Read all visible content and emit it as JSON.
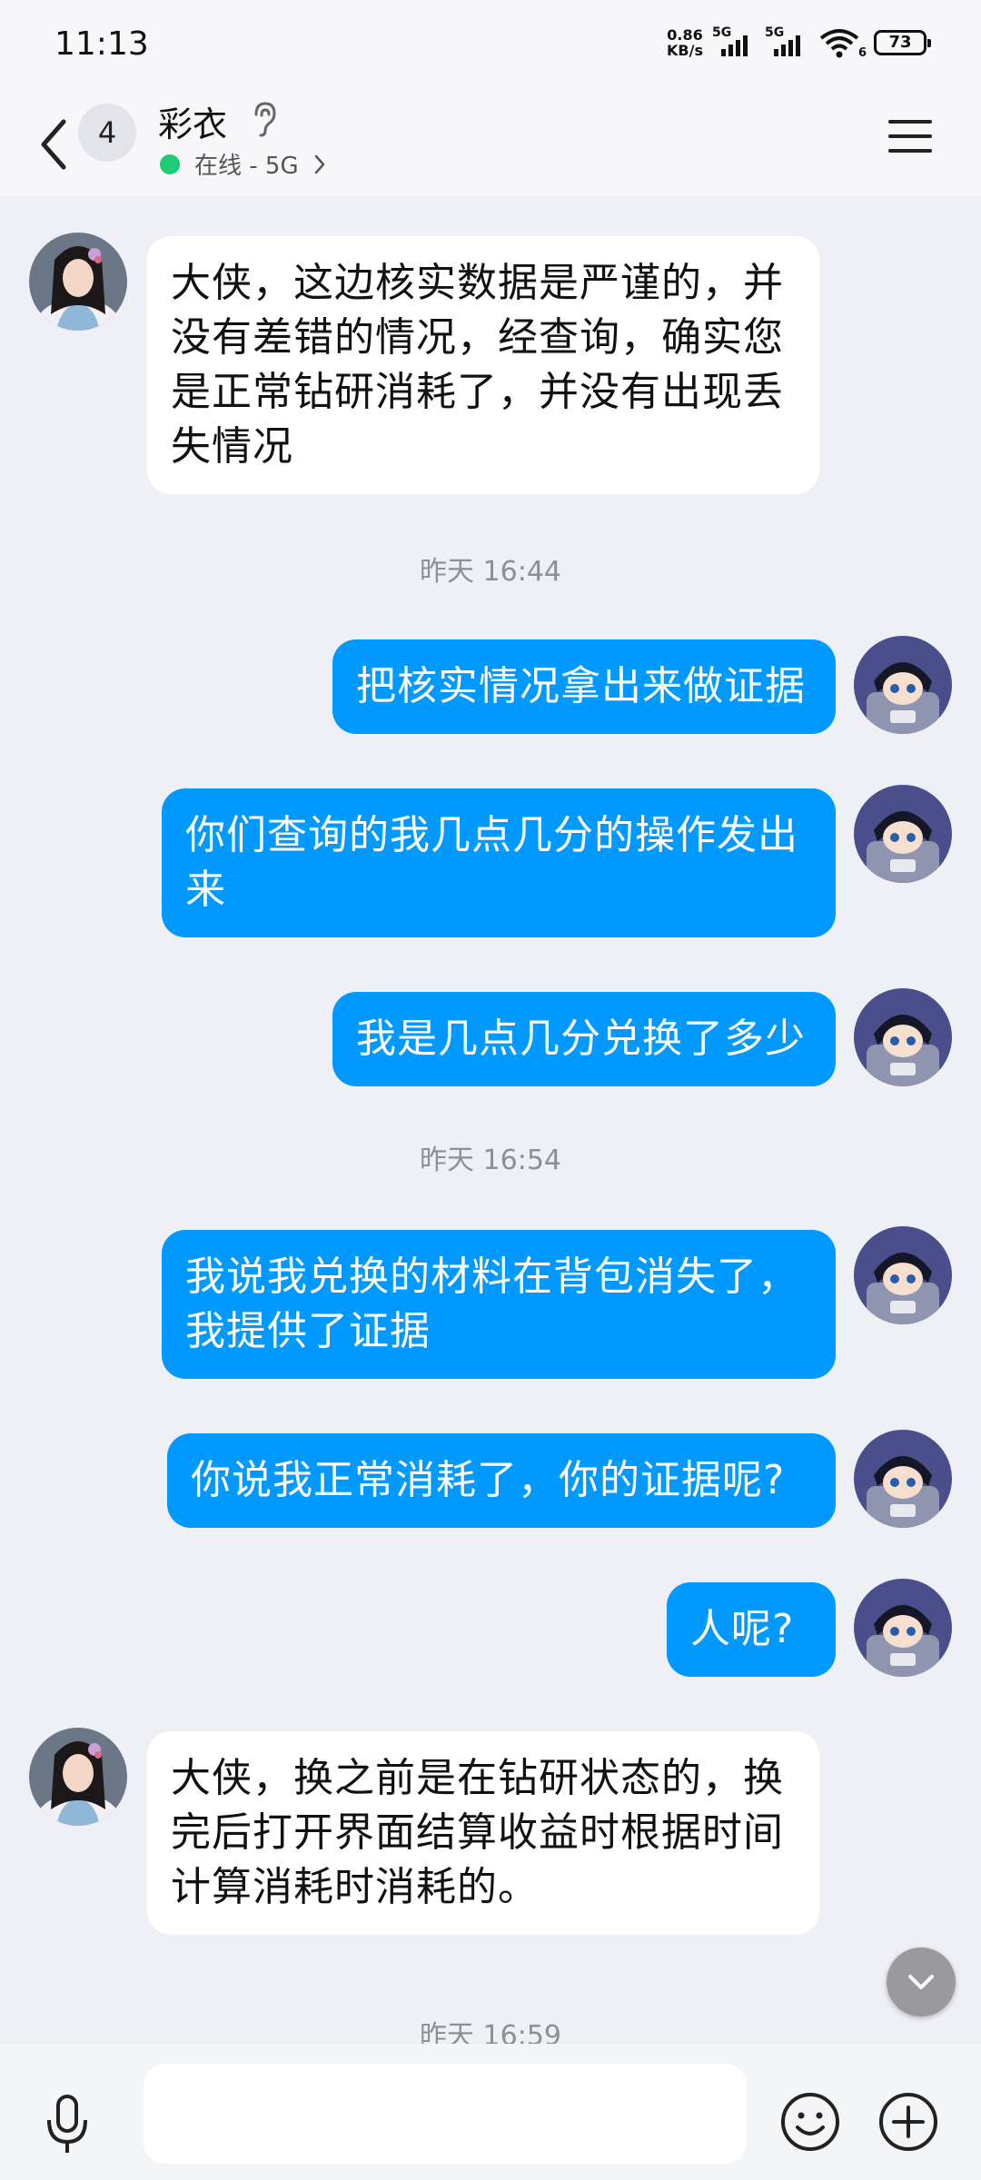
{
  "status_bar": {
    "time": "11:13",
    "net_speed_value": "0.86",
    "net_speed_unit": "KB/s",
    "sim1_label": "5G",
    "sim2_label": "5G",
    "wifi_label": "6",
    "battery": "73"
  },
  "header": {
    "unread_count": "4",
    "contact_name": "彩衣",
    "status_text": "在线 - 5G"
  },
  "messages": [
    {
      "side": "in",
      "text": "大侠，这边核实数据是严谨的，并没有差错的情况，经查询，确实您是正常钻研消耗了，并没有出现丢失情况"
    },
    {
      "type": "time",
      "text": "昨天 16:44"
    },
    {
      "side": "out",
      "text": "把核实情况拿出来做证据"
    },
    {
      "side": "out",
      "text": "你们查询的我几点几分的操作发出来"
    },
    {
      "side": "out",
      "text": "我是几点几分兑换了多少"
    },
    {
      "type": "time",
      "text": "昨天 16:54"
    },
    {
      "side": "out",
      "text": "我说我兑换的材料在背包消失了，我提供了证据"
    },
    {
      "side": "out",
      "text": "你说我正常消耗了，你的证据呢?"
    },
    {
      "side": "out",
      "text": "人呢?"
    },
    {
      "side": "in",
      "text": "大侠，换之前是在钻研状态的，换完后打开界面结算收益时根据时间计算消耗时消耗的。"
    },
    {
      "type": "time",
      "text": "昨天 16:59"
    }
  ],
  "input": {
    "placeholder": "",
    "value": ""
  },
  "colors": {
    "outgoing_bubble": "#0099ff",
    "incoming_bubble": "#ffffff",
    "chat_background": "#eef0f5",
    "online_dot": "#1fcc74"
  },
  "icons": [
    "back-icon",
    "ear-icon",
    "chevron-right-icon",
    "menu-icon",
    "mic-icon",
    "emoji-icon",
    "plus-icon",
    "chevron-down-icon"
  ]
}
